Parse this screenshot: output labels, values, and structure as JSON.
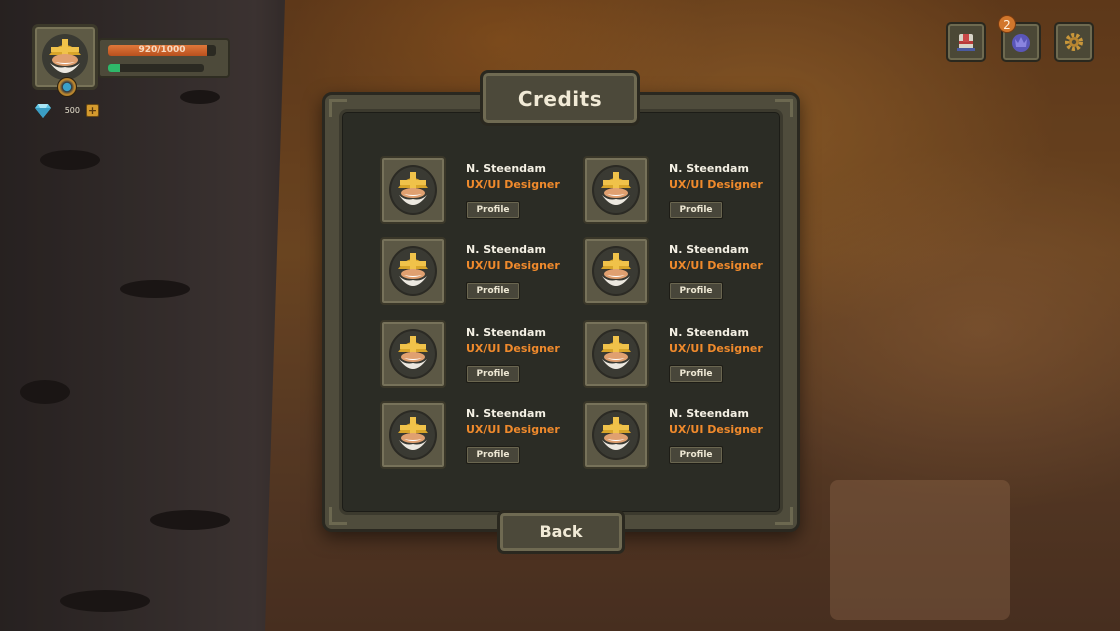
{
  "hud": {
    "hp_text": "920/1000",
    "hp_fraction": 0.92,
    "xp_fraction": 0.12,
    "gems": "500",
    "add_gems_label": "+",
    "notification_count": "2",
    "buttons": [
      {
        "icon": "inventory-chest-icon"
      },
      {
        "icon": "guild-shield-icon"
      },
      {
        "icon": "settings-gear-icon"
      }
    ]
  },
  "credits": {
    "title": "Credits",
    "back_label": "Back",
    "people": [
      {
        "name": "N. Steendam",
        "role": "UX/UI Designer",
        "button": "Profile"
      },
      {
        "name": "N. Steendam",
        "role": "UX/UI Designer",
        "button": "Profile"
      },
      {
        "name": "N. Steendam",
        "role": "UX/UI Designer",
        "button": "Profile"
      },
      {
        "name": "N. Steendam",
        "role": "UX/UI Designer",
        "button": "Profile"
      },
      {
        "name": "N. Steendam",
        "role": "UX/UI Designer",
        "button": "Profile"
      },
      {
        "name": "N. Steendam",
        "role": "UX/UI Designer",
        "button": "Profile"
      },
      {
        "name": "N. Steendam",
        "role": "UX/UI Designer",
        "button": "Profile"
      },
      {
        "name": "N. Steendam",
        "role": "UX/UI Designer",
        "button": "Profile"
      }
    ]
  },
  "colors": {
    "accent_orange": "#f08a2c",
    "panel_dark": "#2b2c25",
    "frame": "#4f4c3c",
    "hp_bar": "#d2682c",
    "xp_bar": "#2fb86a"
  }
}
